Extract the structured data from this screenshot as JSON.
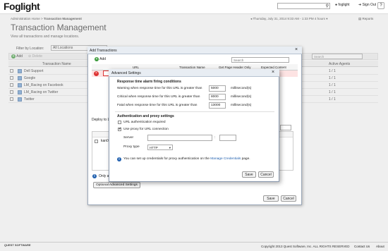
{
  "app": {
    "logo": "Foglight",
    "search_icon": "search-icon",
    "user": "foglight",
    "signout": "Sign Out",
    "help": "?"
  },
  "header": {
    "breadcrumb_home": "Administration Home",
    "breadcrumb_sep": " > ",
    "breadcrumb_current": "Transaction Management",
    "datetime": "Thursday, July 31, 2014 9:33 AM - 1:33 PM 4 hours",
    "reports": "Reports",
    "title": "Transaction Management",
    "description": "View all transactions and manage locations."
  },
  "filter": {
    "label": "Filter by Location:",
    "value": "All Locations"
  },
  "toolbar": {
    "add": "Add",
    "delete": "Delete",
    "search_placeholder": "Search"
  },
  "table": {
    "col_name": "Transaction Name",
    "col_agents": "Active Agents",
    "rows": [
      {
        "name": "Dell Support",
        "agents": "1 / 1"
      },
      {
        "name": "Google",
        "agents": "1 / 1"
      },
      {
        "name": "LM_Racing on Facebook",
        "agents": "1 / 1"
      },
      {
        "name": "LM_Racing on Twitter",
        "agents": "1 / 1"
      },
      {
        "name": "Twitter",
        "agents": "1 / 1"
      }
    ]
  },
  "add_dialog": {
    "title": "Add Transactions",
    "add": "Add",
    "search_placeholder": "Search",
    "col_url": "URL",
    "col_name": "Transaction Name",
    "col_header": "Get Page Header Only",
    "col_expected": "Expected Content",
    "deploy_label": "Deploy to Lo",
    "list_item": "kan01",
    "note": "Only ac",
    "optional_btn": "Optional Advanced Settings",
    "save": "Save",
    "cancel": "Cancel"
  },
  "adv_dialog": {
    "title": "Advanced Settings",
    "section1": "Response time alarm firing conditions",
    "warning_label": "Warning when response time for this URL is greater than",
    "warning_value": "5000",
    "critical_label": "Critical when response time for this URL is greater than",
    "critical_value": "8000",
    "fatal_label": "Fatal when response time for this URL is greater than",
    "fatal_value": "13000",
    "unit": "millisecond(s)",
    "section2": "Authentication and proxy settings",
    "url_auth": "URL authentication required",
    "use_proxy": "Use proxy for URL connection",
    "server_label": "Server",
    "colon": ":",
    "proxy_type_label": "Proxy type",
    "proxy_type_value": "HTTP",
    "note_prefix": "You can set up credentials for proxy authentication on the ",
    "note_link": "Manage Credentials",
    "note_suffix": " page.",
    "save": "Save",
    "cancel": "Cancel"
  },
  "footer": {
    "brand": "QUEST SOFTWARE",
    "copyright": "Copyright 2013 Quest Software, Inc. ALL RIGHTS RESERVED",
    "contact": "Contact Us",
    "about": "About"
  }
}
